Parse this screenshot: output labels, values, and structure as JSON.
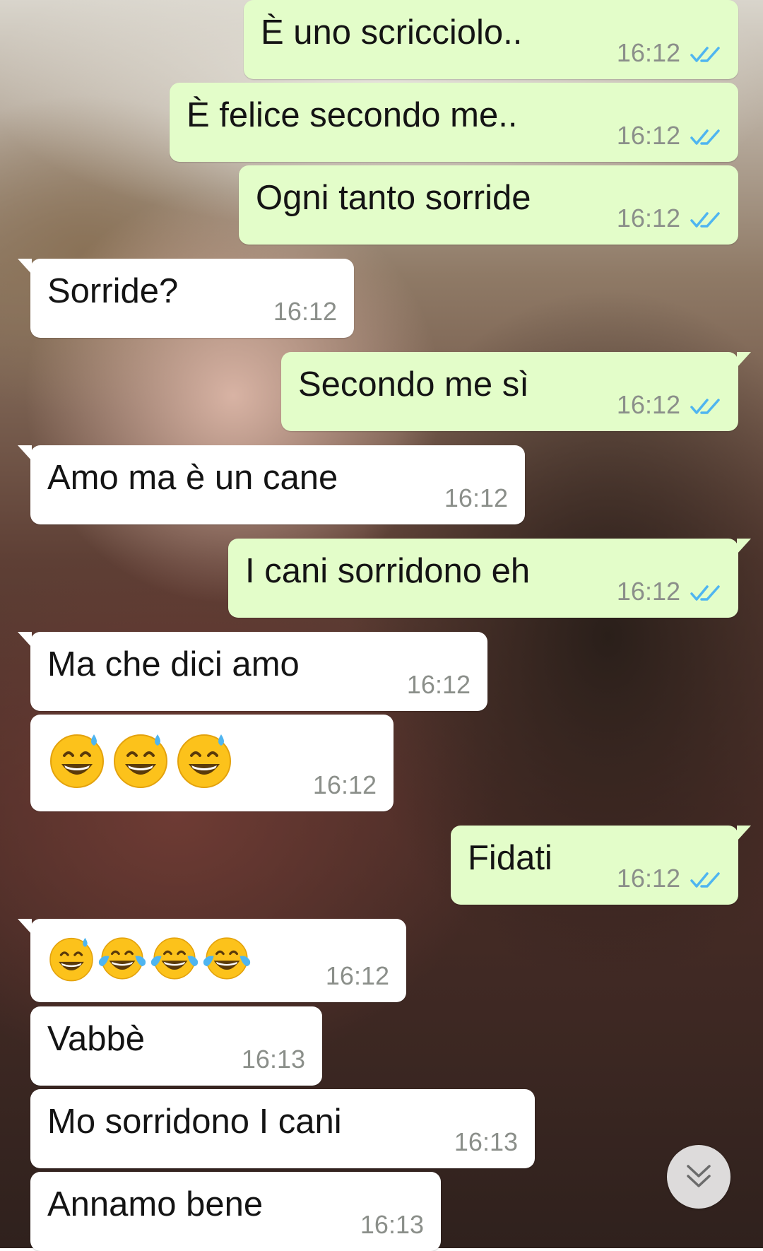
{
  "chat": {
    "messages": [
      {
        "text": "È uno scricciolo..",
        "time": "16:12",
        "direction": "outgoing",
        "status": "read"
      },
      {
        "text": "È felice secondo me..",
        "time": "16:12",
        "direction": "outgoing",
        "status": "read"
      },
      {
        "text": "Ogni tanto sorride",
        "time": "16:12",
        "direction": "outgoing",
        "status": "read"
      },
      {
        "text": "Sorride?",
        "time": "16:12",
        "direction": "incoming"
      },
      {
        "text": "Secondo me sì",
        "time": "16:12",
        "direction": "outgoing",
        "status": "read"
      },
      {
        "text": "Amo ma è un cane",
        "time": "16:12",
        "direction": "incoming"
      },
      {
        "text": "I cani sorridono eh",
        "time": "16:12",
        "direction": "outgoing",
        "status": "read"
      },
      {
        "text": "Ma che dici amo",
        "time": "16:12",
        "direction": "incoming"
      },
      {
        "emojis": [
          "grinning-sweat-emoji",
          "grinning-sweat-emoji",
          "grinning-sweat-emoji"
        ],
        "time": "16:12",
        "direction": "incoming"
      },
      {
        "text": "Fidati",
        "time": "16:12",
        "direction": "outgoing",
        "status": "read"
      },
      {
        "emojis": [
          "grinning-sweat-emoji",
          "tears-of-joy-emoji",
          "tears-of-joy-emoji",
          "tears-of-joy-emoji"
        ],
        "time": "16:12",
        "direction": "incoming"
      },
      {
        "text": "Vabbè",
        "time": "16:13",
        "direction": "incoming"
      },
      {
        "text": "Mo sorridono I cani",
        "time": "16:13",
        "direction": "incoming"
      },
      {
        "text": "Annamo bene",
        "time": "16:13",
        "direction": "incoming"
      }
    ]
  },
  "scroll_button": {
    "icon": "double-chevron-down-icon"
  },
  "colors": {
    "outgoing_bubble": "#e3fdc9",
    "incoming_bubble": "#ffffff",
    "read_ticks": "#4fb5f0",
    "timestamp": "#8b8f8a"
  }
}
